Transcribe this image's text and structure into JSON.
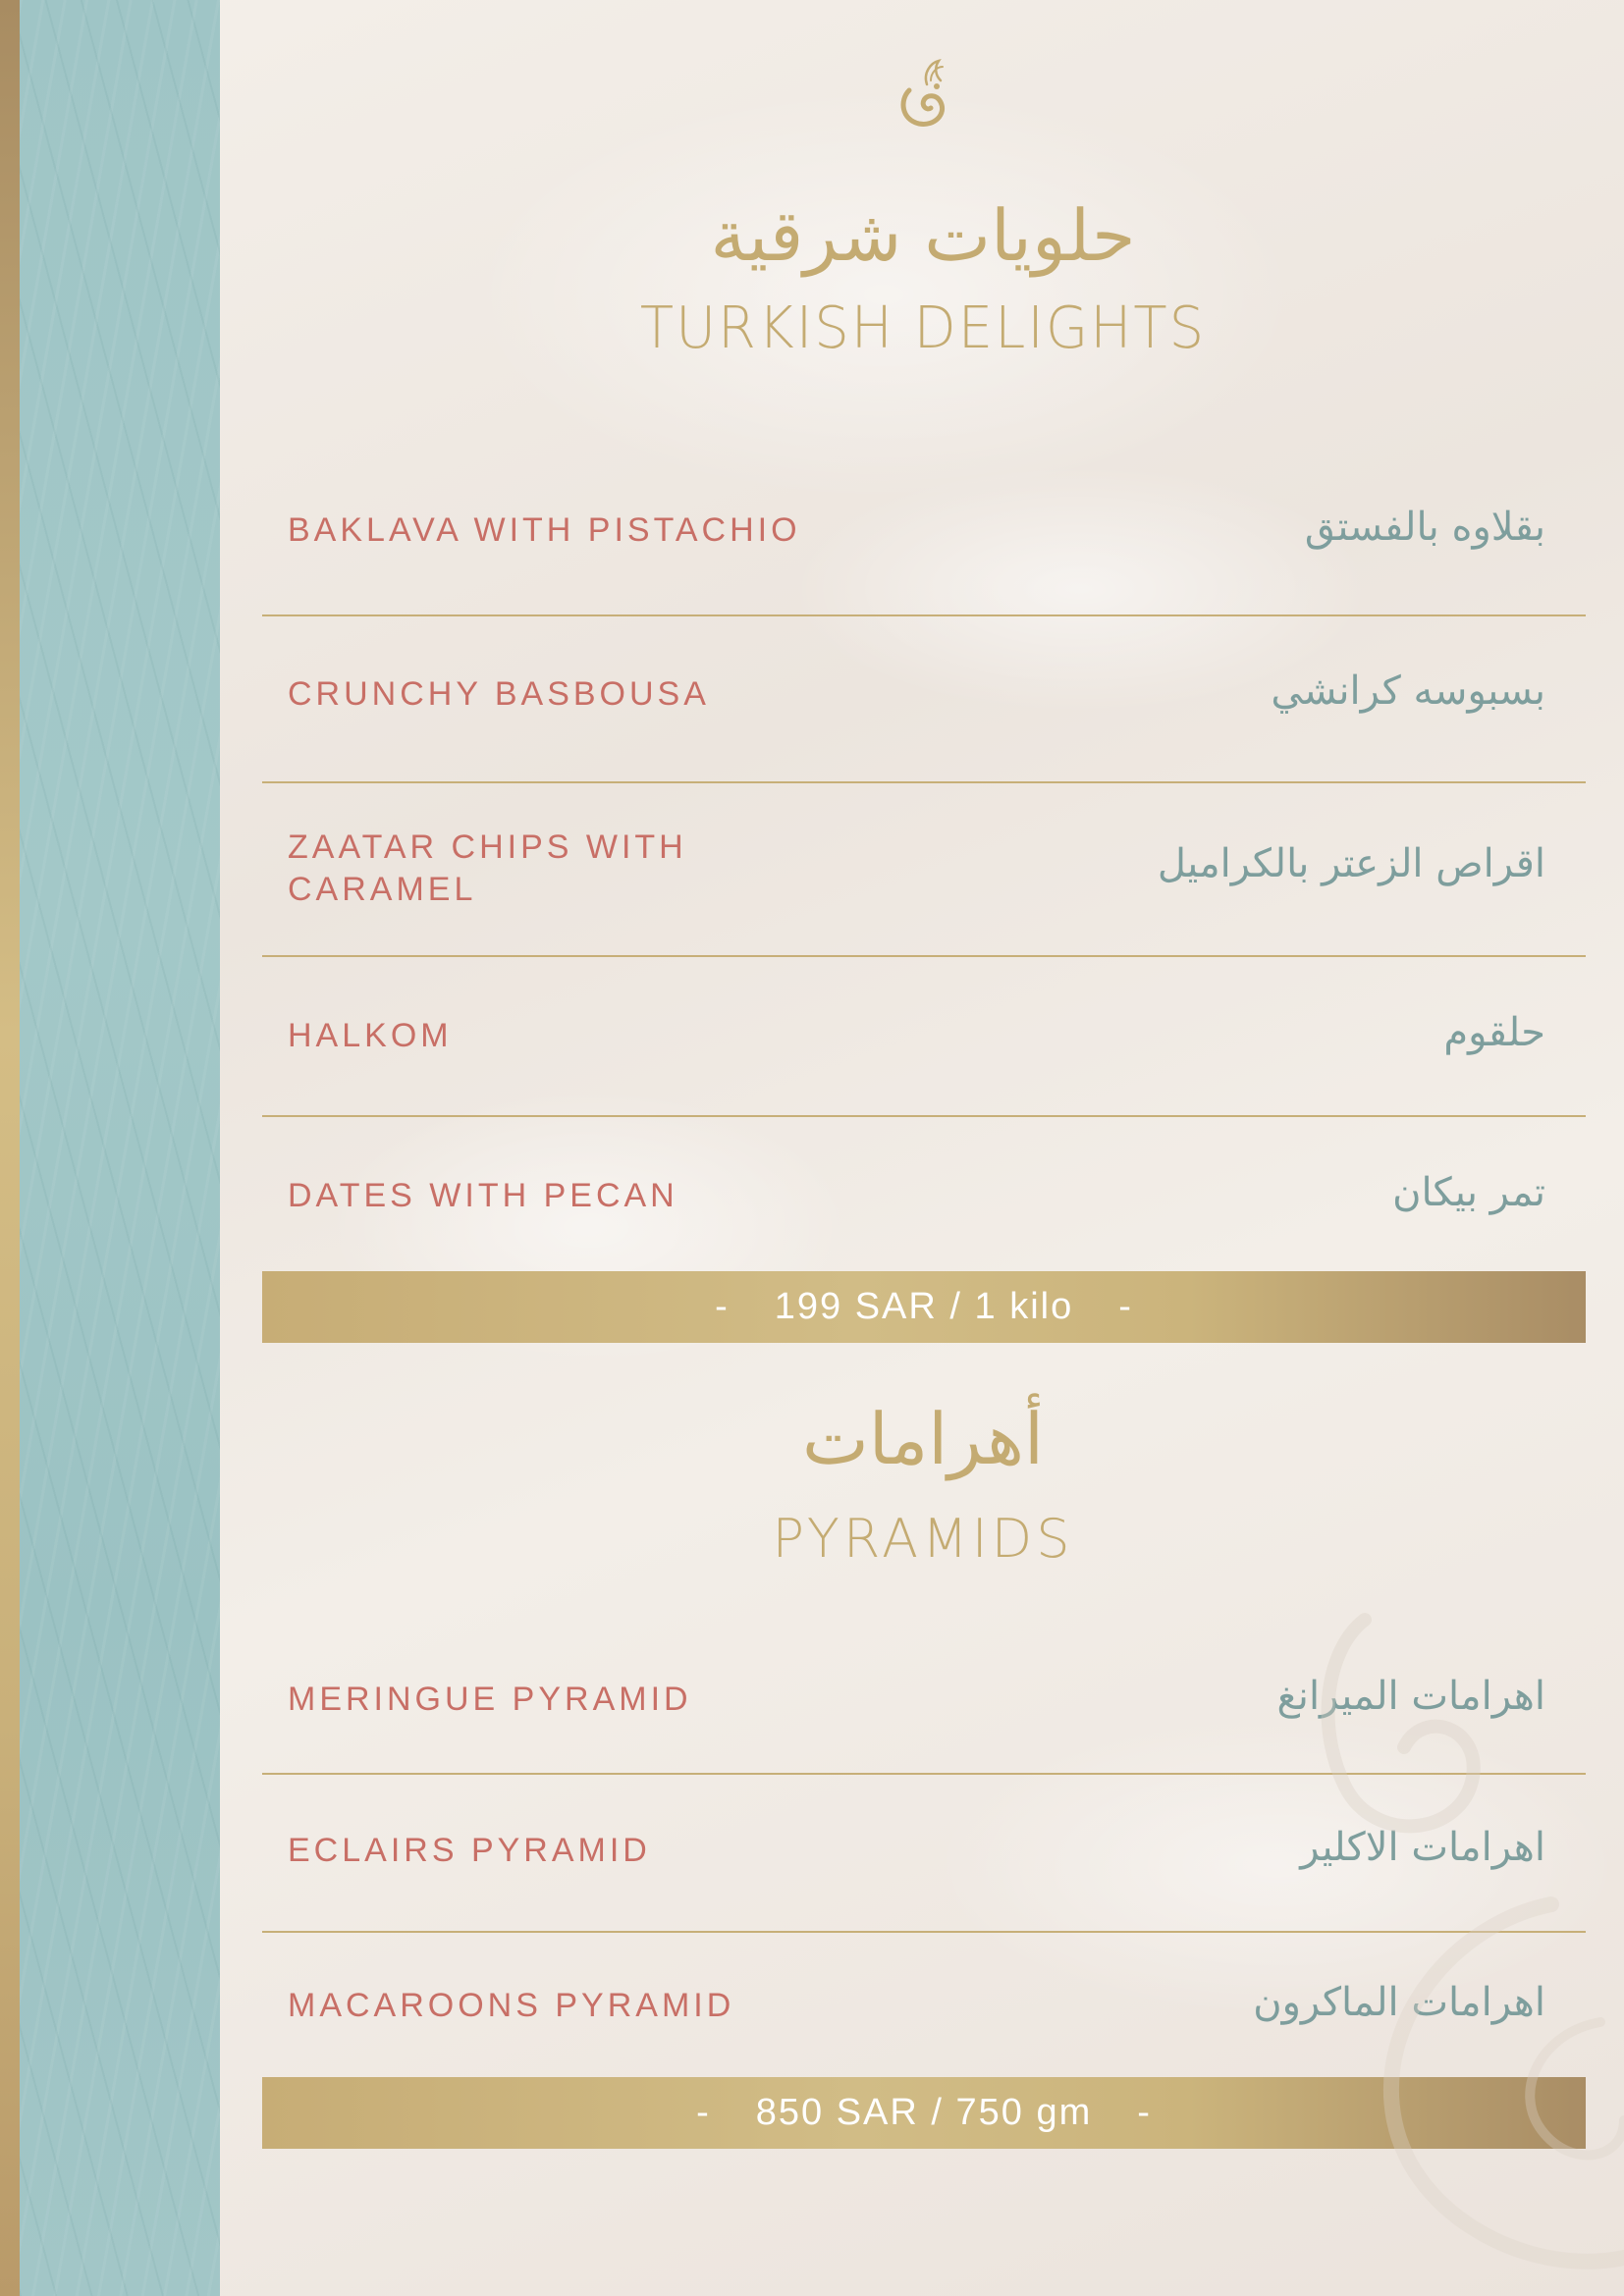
{
  "colors": {
    "gold": "#c4ab72",
    "teal_panel": "#a0c6c7",
    "item_english": "#c86f66",
    "item_arabic": "#7e9e9d",
    "background": "#f2ece6",
    "price_text": "#ffffff"
  },
  "icons": {
    "logo": "ornamental-swirl-logo",
    "watermark": "decorative-swirl-watermark"
  },
  "sections": [
    {
      "title_ar": "حلويات شرقية",
      "title_en": "TURKISH DELIGHTS",
      "items": [
        {
          "en": "BAKLAVA WITH PISTACHIO",
          "ar": "بقلاوه بالفستق"
        },
        {
          "en": "CRUNCHY BASBOUSA",
          "ar": "بسبوسه كرانشي"
        },
        {
          "en": "ZAATAR CHIPS WITH CARAMEL",
          "ar": "اقراص الزعتر بالكراميل"
        },
        {
          "en": "HALKOM",
          "ar": "حلقوم"
        },
        {
          "en": "DATES WITH PECAN",
          "ar": "تمر بيكان"
        }
      ],
      "price": {
        "dash_left": "-",
        "text": "199 SAR / 1 kilo",
        "dash_right": "-"
      }
    },
    {
      "title_ar": "أهرامات",
      "title_en": "PYRAMIDS",
      "items": [
        {
          "en": "MERINGUE PYRAMID",
          "ar": "اهرامات الميرانغ"
        },
        {
          "en": "ECLAIRS PYRAMID",
          "ar": "اهرامات الاكلير"
        },
        {
          "en": "MACAROONS PYRAMID",
          "ar": "اهرامات الماكرون"
        }
      ],
      "price": {
        "dash_left": "-",
        "text": "850 SAR / 750 gm",
        "dash_right": "-"
      }
    }
  ]
}
